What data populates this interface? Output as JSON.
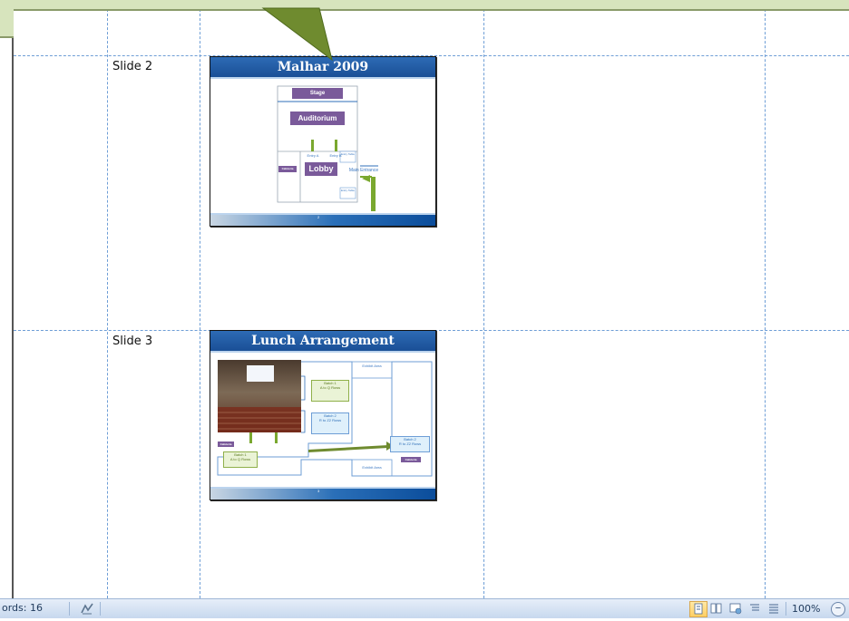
{
  "slides": [
    {
      "label": "Slide 2",
      "title": "Malhar 2009",
      "page_number": "2",
      "plan": {
        "stage": "Stage",
        "auditorium": "Auditorium",
        "lobby": "Lobby",
        "cafeteria": "Cafeteria",
        "main_entrance": "Main Entrance",
        "entry_a": "Entry A",
        "entry_b": "Entry B",
        "table_1": "Entry Table",
        "table_2": "Entry Table"
      }
    },
    {
      "label": "Slide 3",
      "title": "Lunch Arrangement",
      "page_number": "3",
      "plan": {
        "exhibit_top": "Exhibit Area",
        "exhibit_bottom": "Exhibit Area",
        "batch1_a": "Batch 1\nA to Q Rows",
        "batch2_a": "Batch 2\nR to Z2 Rows",
        "batch2_b": "Batch 2\nR to Z2 Rows",
        "batch1_b": "Batch 1\nA to Q Rows",
        "cafeteria_left": "Cafeteria",
        "cafeteria_right": "Cafeteria"
      }
    }
  ],
  "status_bar": {
    "word_count": "ords: 16",
    "zoom_level": "100%",
    "zoom_out": "−"
  },
  "colors": {
    "slide_title_bg": "#1a4f96",
    "callout_fill": "#d7e4bd",
    "arrow_fill": "#6f8b2f",
    "gridline": "#6e9ed6"
  }
}
